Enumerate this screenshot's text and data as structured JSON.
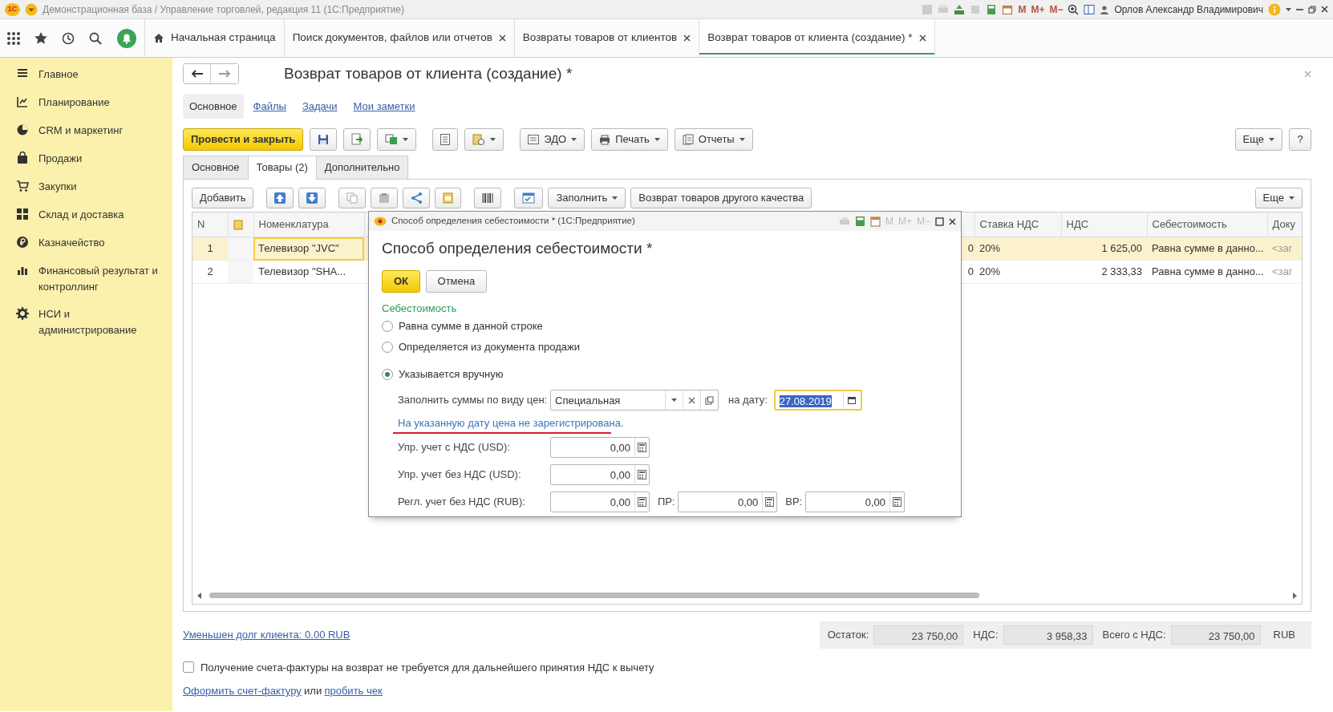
{
  "window": {
    "logo": "1С",
    "title": "Демонстрационная база / Управление торговлей, редакция 11  (1С:Предприятие)",
    "memory_buttons": [
      "M",
      "M+",
      "M−"
    ],
    "user": "Орлов Александр Владимирович"
  },
  "section_tabs": [
    {
      "label": "Начальная страница",
      "kind": "home",
      "selected": false
    },
    {
      "label": "Поиск документов, файлов или отчетов",
      "kind": "closable",
      "selected": false
    },
    {
      "label": "Возвраты товаров от клиентов",
      "kind": "closable",
      "selected": false
    },
    {
      "label": "Возврат товаров от клиента (создание) *",
      "kind": "closable",
      "selected": true
    }
  ],
  "sidebar": {
    "items": [
      {
        "label": "Главное"
      },
      {
        "label": "Планирование"
      },
      {
        "label": "CRM и маркетинг"
      },
      {
        "label": "Продажи"
      },
      {
        "label": "Закупки"
      },
      {
        "label": "Склад и доставка"
      },
      {
        "label": "Казначейство"
      },
      {
        "label": "Финансовый результат и контроллинг"
      },
      {
        "label": "НСИ и администрирование"
      }
    ]
  },
  "form": {
    "title": "Возврат товаров от клиента (создание) *",
    "nav": [
      {
        "label": "Основное",
        "selected": true
      },
      {
        "label": "Файлы",
        "selected": false
      },
      {
        "label": "Задачи",
        "selected": false
      },
      {
        "label": "Мои заметки",
        "selected": false
      }
    ],
    "commands": {
      "post_close": "Провести и закрыть",
      "edo": "ЭДО",
      "print": "Печать",
      "reports": "Отчеты",
      "more": "Еще",
      "help": "?"
    },
    "tabs": [
      {
        "label": "Основное",
        "selected": false
      },
      {
        "label": "Товары (2)",
        "selected": true
      },
      {
        "label": "Дополнительно",
        "selected": false
      }
    ],
    "table_toolbar": {
      "add": "Добавить",
      "fill": "Заполнить",
      "other_quality": "Возврат товаров другого качества",
      "more": "Еще"
    },
    "table": {
      "columns": [
        {
          "kind": "text",
          "label": "N"
        },
        {
          "kind": "icon"
        },
        {
          "kind": "text",
          "label": "Номенклатура"
        },
        {
          "kind": "text",
          "label": "Ставка НДС"
        },
        {
          "kind": "text",
          "label": "НДС"
        },
        {
          "kind": "text",
          "label": "Себестоимость"
        },
        {
          "kind": "text",
          "label": "Доку"
        }
      ],
      "rows": [
        {
          "n": "1",
          "item": "Телевизор \"JVC\"",
          "column_4": "0",
          "vat_rate": "20%",
          "vat": "1 625,00",
          "cost": "Равна сумме в данно...",
          "doc": "<заг",
          "selected": true
        },
        {
          "n": "2",
          "item": "Телевизор \"SHA...",
          "column_4": "0",
          "vat_rate": "20%",
          "vat": "2 333,33",
          "cost": "Равна сумме в данно...",
          "doc": "<заг",
          "selected": false
        }
      ]
    },
    "debt_link": "Уменьшен долг клиента: 0.00 RUB",
    "totals": [
      {
        "label": "Остаток:",
        "value": "23 750,00"
      },
      {
        "label": "НДС:",
        "value": "3 958,33"
      },
      {
        "label": "Всего с НДС:",
        "value": "23 750,00"
      }
    ],
    "currency": "RUB",
    "invoice_checkbox": {
      "label": "Получение счета-фактуры на возврат не требуется для дальнейшего принятия НДС к вычету",
      "checked": false
    },
    "links": {
      "invoice": "Оформить счет-фактуру",
      "or": "или",
      "receipt": "пробить чек"
    }
  },
  "dialog": {
    "window_title": "Способ определения себестоимости *  (1С:Предприятие)",
    "memory_buttons": [
      "M",
      "M+",
      "M−"
    ],
    "heading": "Способ определения себестоимости *",
    "ok": "ОК",
    "cancel": "Отмена",
    "group": "Себестоимость",
    "options": [
      {
        "label": "Равна сумме в данной строке",
        "selected": false
      },
      {
        "label": "Определяется из документа продажи",
        "selected": false
      },
      {
        "label": "Указывается вручную",
        "selected": true
      }
    ],
    "price_type_label": "Заполнить суммы по виду цен:",
    "price_type": "Специальная",
    "date_label": "на дату:",
    "date": {
      "value": "27.08.2019",
      "focused": true,
      "highlighted": true
    },
    "warning": "На указанную дату цена не зарегистрирована.",
    "amounts": [
      {
        "label": "Упр. учет с НДС (USD):",
        "value": "0,00"
      },
      {
        "label": "Упр. учет без НДС (USD):",
        "value": "0,00"
      },
      {
        "label": "Регл. учет без НДС (RUB):",
        "value": "0,00"
      }
    ],
    "extra_amounts": [
      {
        "label": "ПР:",
        "value": "0,00"
      },
      {
        "label": "ВР:",
        "value": "0,00"
      }
    ]
  }
}
